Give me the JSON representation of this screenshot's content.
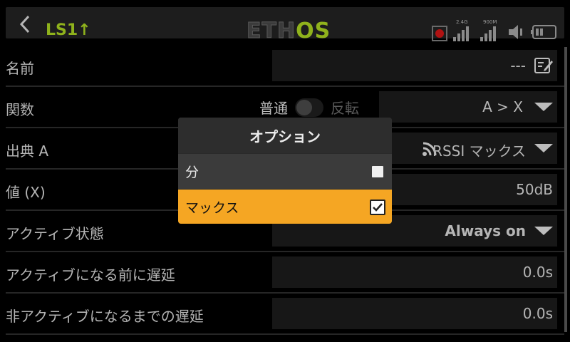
{
  "header": {
    "title": "LS1↑",
    "logo_left": "ETH",
    "logo_right": "OS",
    "signal_1_label": "2.4G",
    "signal_2_label": "900M"
  },
  "rows": [
    {
      "label": "名前",
      "value": "---"
    },
    {
      "label": "関数",
      "toggle_left": "普通",
      "toggle_right": "反転",
      "value": "A > X"
    },
    {
      "label": "出典 A",
      "value": "RSSI マックス"
    },
    {
      "label": "値 (X)",
      "value": "50dB"
    },
    {
      "label": "アクティブ状態",
      "value": "Always on"
    },
    {
      "label": "アクティブになる前に遅延",
      "value": "0.0s"
    },
    {
      "label": "非アクティブになるまでの遅延",
      "value": "0.0s"
    }
  ],
  "dialog": {
    "title": "オプション",
    "options": [
      {
        "label": "分",
        "checked": false
      },
      {
        "label": "マックス",
        "checked": true
      }
    ]
  },
  "colors": {
    "accent": "#8fb21c",
    "highlight": "#f5a623"
  }
}
